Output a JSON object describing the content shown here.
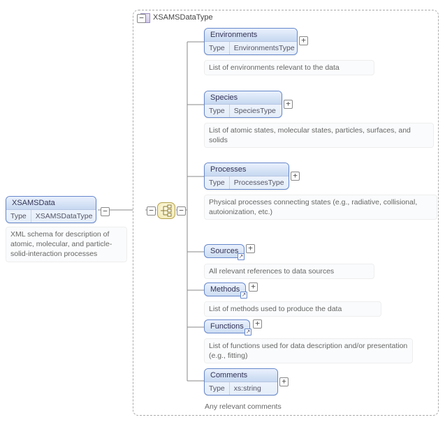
{
  "root": {
    "name": "XSAMSData",
    "type_label": "Type",
    "type_value": "XSAMSDataType",
    "description": "XML schema for description of atomic, molecular, and particle-solid-interaction processes"
  },
  "complex_type": {
    "label": "XSAMSDataType"
  },
  "children": [
    {
      "name": "Environments",
      "type_label": "Type",
      "type_value": "EnvironmentsType",
      "description": "List of environments relevant to the data",
      "has_type_row": true,
      "is_ref": false
    },
    {
      "name": "Species",
      "type_label": "Type",
      "type_value": "SpeciesType",
      "description": "List of atomic states, molecular states, particles, surfaces, and solids",
      "has_type_row": true,
      "is_ref": false
    },
    {
      "name": "Processes",
      "type_label": "Type",
      "type_value": "ProcessesType",
      "description": "Physical processes connecting states (e.g., radiative, collisional, autoionization, etc.)",
      "has_type_row": true,
      "is_ref": false
    },
    {
      "name": "Sources",
      "description": "All relevant references to data sources",
      "has_type_row": false,
      "is_ref": true
    },
    {
      "name": "Methods",
      "description": "List of methods used to produce the data",
      "has_type_row": false,
      "is_ref": true
    },
    {
      "name": "Functions",
      "description": "List of functions used for data description and/or presentation (e.g., fitting)",
      "has_type_row": false,
      "is_ref": true
    },
    {
      "name": "Comments",
      "type_label": "Type",
      "type_value": "xs:string",
      "description": "Any relevant comments",
      "has_type_row": true,
      "is_ref": false
    }
  ],
  "glyphs": {
    "minus": "−",
    "plus": "+",
    "arrow": "↗"
  }
}
